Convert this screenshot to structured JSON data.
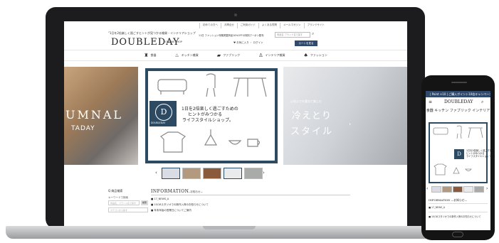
{
  "laptop": {
    "top_links": [
      "初めての方へ",
      "お問合せ",
      "ご利用ガイド",
      "よくある質問",
      "メールマガジン",
      "ブランドサイト"
    ],
    "tagline": "\"1日を2倍楽しく過ごすヒントが見つかる雑貨・インテリアショップ",
    "logo": "DOUBLEDAY",
    "logo_sub": "ONLINE SHOP",
    "notice": "11日 ファッション特集掲載商品10%OFFの特別クーポン配布",
    "search_placeholder": "商品名 ブランド名で探す",
    "account_text": "♥ お気に入り ・ ログイン",
    "login_button": "カートを見る",
    "nav": [
      {
        "icon": "fork-knife-icon",
        "glyph": "♜",
        "label": "食器"
      },
      {
        "icon": "pot-icon",
        "glyph": "♨",
        "label": "キッチン雑貨"
      },
      {
        "icon": "fabric-icon",
        "glyph": "▰",
        "label": "ファブリック"
      },
      {
        "icon": "lamp-icon",
        "glyph": "♙",
        "label": "インテリア雑貨"
      },
      {
        "icon": "shirt-icon",
        "glyph": "♠",
        "label": "ファッション"
      }
    ],
    "slide_left": {
      "line1": "UMNAL",
      "line2": "TADAY"
    },
    "slide_center": {
      "brand": "DOUBLEDAY",
      "letter": "D",
      "catch1": "1日を2倍楽しく過ごすための",
      "catch2": "ヒントがみつかる",
      "catch3": "ライフスタイルショップ。"
    },
    "slide_right": {
      "lead": "心地よさを重ねて楽しむ",
      "line1": "冷えとり",
      "line2": "スタイル"
    },
    "slider_prev": "‹",
    "slider_next": "›",
    "carousel_arrow": "›",
    "sidebar": {
      "title": "Q 商品検索",
      "label": "キーワードで検索",
      "input_placeholder": "商品名、ブランド名で探す",
      "search_btn": "検索",
      "select_placeholder": "カテゴリから探す"
    },
    "info": {
      "title": "INFORMATION",
      "subtitle": "—お知らせ—",
      "items": [
        "■ 17_NEWS_A",
        "■ 10/18スタジオでの新作入荷のお知らせについて",
        "■ 年末年始の営業日についてご案内"
      ]
    }
  },
  "phone": {
    "topbar": "| Point +10 | ご購入ポイント10倍キャンペーン",
    "logo": "DOUBLEDAY",
    "menu_icon_glyph": "≡",
    "search_glyph": "⌕",
    "nav": [
      "食器",
      "キッチン",
      "ファブリック",
      "インテリア",
      "ファッション"
    ],
    "hero_letter": "D",
    "hero_catch": "1日を2倍楽しく過ごすための\nヒントがみつかる\nライフスタイルショップ。",
    "prev": "‹",
    "next": "›",
    "info_title": "INFORMATION —お知らせ—",
    "items": [
      "■ 17_NEWS_A",
      "■ 10/18スタジオでの新作入荷のお知らせについて"
    ]
  },
  "colors": {
    "navy": "#2d4a63",
    "accent": "#2f4a6d"
  }
}
